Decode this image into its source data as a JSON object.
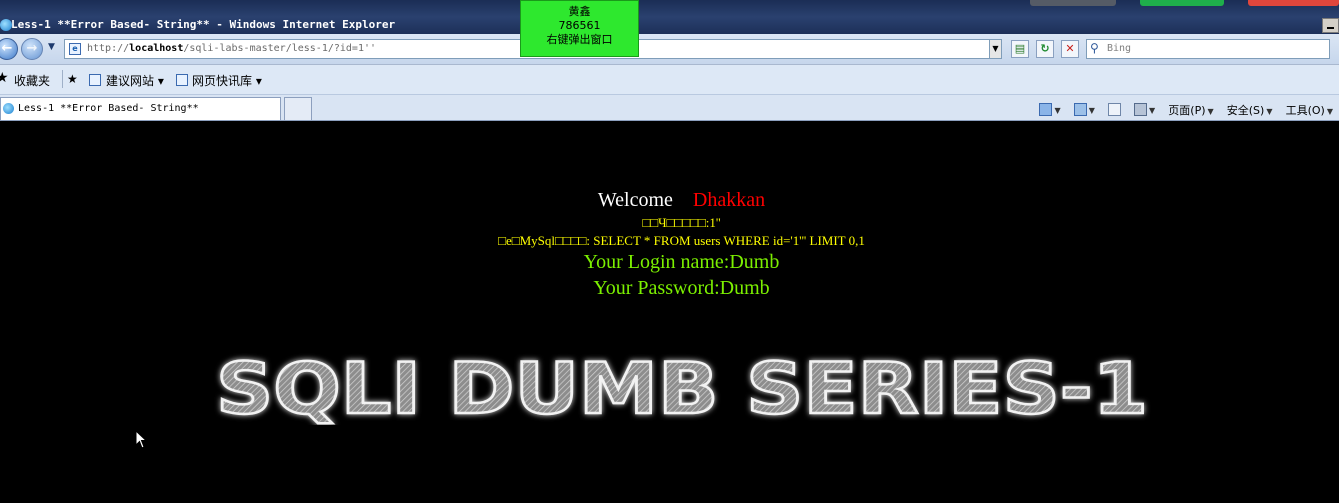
{
  "window": {
    "title": "Less-1 **Error Based- String** - Windows Internet Explorer"
  },
  "popup": {
    "line1": "黄鑫",
    "line2": "786561",
    "line3": "右键弹出窗口"
  },
  "address": {
    "url_prefix": "http://",
    "url_host": "localhost",
    "url_path": "/sqli-labs-master/less-1/?id=1''",
    "search_placeholder": "Bing"
  },
  "favorites": {
    "label": "收藏夹",
    "suggested_sites": "建议网站",
    "web_slice": "网页快讯库"
  },
  "tabs": [
    {
      "label": "Less-1 **Error Based- String**"
    }
  ],
  "commands": {
    "page": "页面(P)",
    "safety": "安全(S)",
    "tools": "工具(O)"
  },
  "page": {
    "welcome": "Welcome",
    "name": "Dhakkan",
    "error_line1": "□□Ч□□□□□:1''",
    "error_line2": "□e□MySql□□□□: SELECT * FROM users WHERE id='1''' LIMIT 0,1",
    "login_name": "Your Login name:Dumb",
    "password": "Your Password:Dumb",
    "banner": "SQLI DUMB SERIES-1"
  }
}
